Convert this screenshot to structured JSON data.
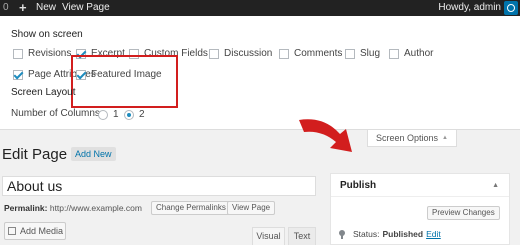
{
  "admin_bar": {
    "counter": "0",
    "new_label": "New",
    "view_page_label": "View Page",
    "greeting": "Howdy, admin"
  },
  "screen_options": {
    "show_on_screen_heading": "Show on screen",
    "checkboxes": [
      {
        "label": "Revisions",
        "checked": false
      },
      {
        "label": "Excerpt",
        "checked": true
      },
      {
        "label": "Custom Fields",
        "checked": false
      },
      {
        "label": "Discussion",
        "checked": false
      },
      {
        "label": "Comments",
        "checked": false
      },
      {
        "label": "Slug",
        "checked": false
      },
      {
        "label": "Author",
        "checked": false
      },
      {
        "label": "Page Attributes",
        "checked": true
      },
      {
        "label": "Featured Image",
        "checked": true
      }
    ],
    "layout_heading": "Screen Layout",
    "columns_label": "Number of Columns:",
    "column_options": [
      {
        "label": "1",
        "selected": false
      },
      {
        "label": "2",
        "selected": true
      }
    ],
    "tab_label": "Screen Options",
    "tab_arrow": "▲",
    "highlight_color": "#d21e1e"
  },
  "editor": {
    "page_heading": "Edit Page",
    "add_new_label": "Add New",
    "post_title": "About us",
    "permalink_label": "Permalink:",
    "permalink_url": "http://www.example.com",
    "change_permalinks_label": "Change Permalinks",
    "view_page_label": "View Page",
    "add_media_label": "Add Media",
    "visual_tab": "Visual",
    "text_tab": "Text"
  },
  "publish_box": {
    "title": "Publish",
    "toggle_arrow": "▲",
    "preview_label": "Preview Changes",
    "status_label": "Status:",
    "status_value": "Published",
    "edit_label": "Edit"
  },
  "colors": {
    "admin_bar": "#222222",
    "link": "#0073aa",
    "annotation_red": "#d21e1e"
  }
}
